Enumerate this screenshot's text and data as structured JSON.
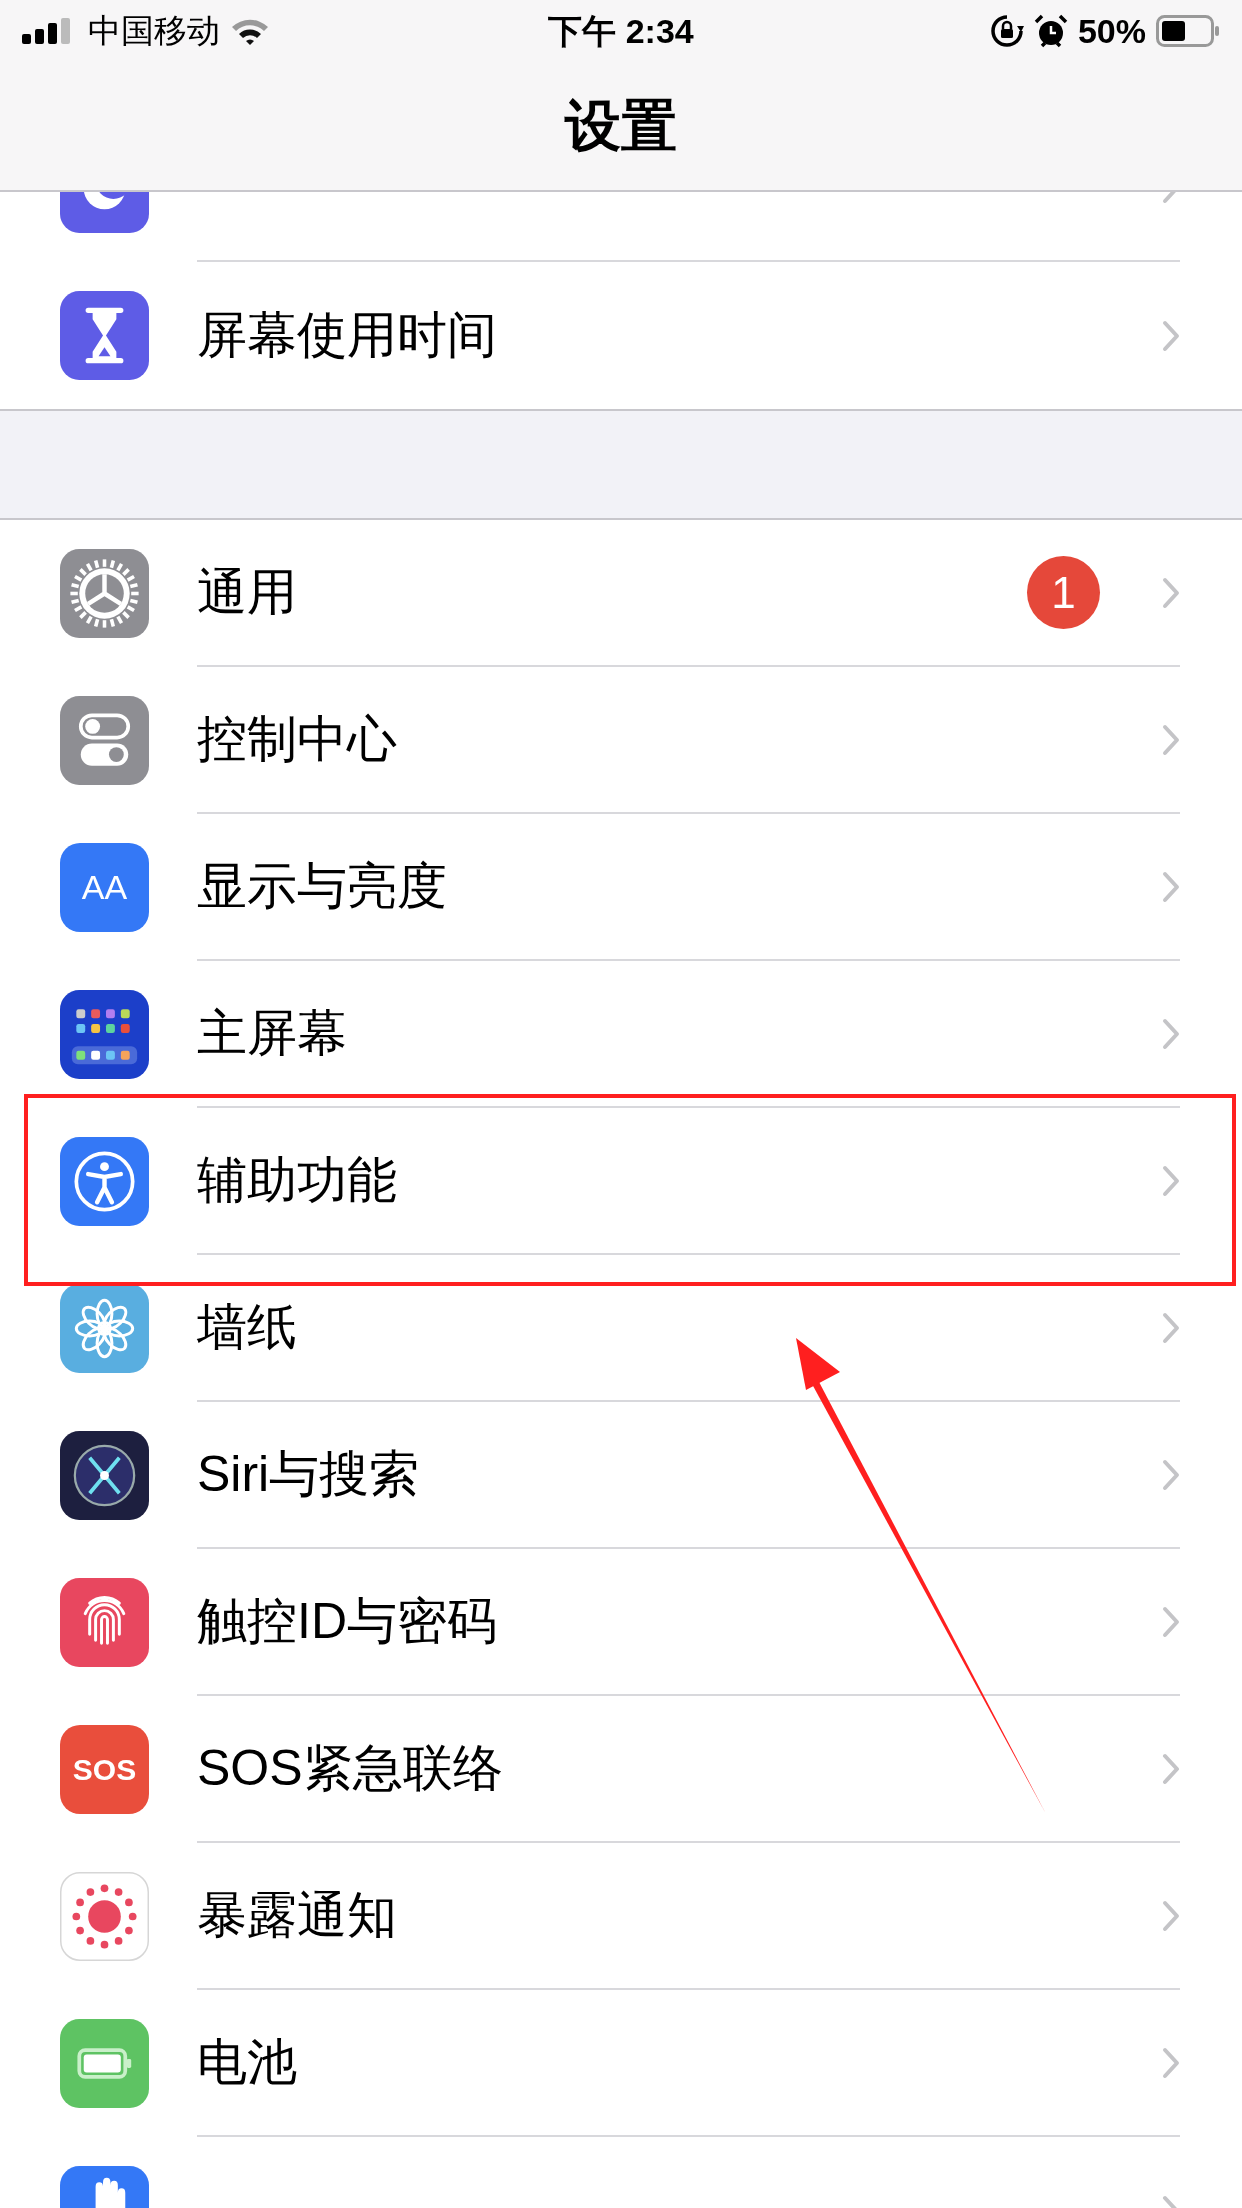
{
  "status_bar": {
    "carrier": "中国移动",
    "time": "下午 2:34",
    "battery": "50%"
  },
  "navigation": {
    "title": "设置"
  },
  "groups": [
    {
      "rows": [
        {
          "highlighted": false
        },
        {
          "label": "屏幕使用时间",
          "highlighted": false
        }
      ]
    },
    {
      "rows": [
        {
          "label": "通用",
          "badge": "1",
          "highlighted": false
        },
        {
          "label": "控制中心",
          "highlighted": false
        },
        {
          "label": "显示与亮度",
          "icon_label": "AA",
          "highlighted": false
        },
        {
          "label": "主屏幕",
          "highlighted": false
        },
        {
          "label": "辅助功能",
          "highlighted": true
        },
        {
          "label": "墙纸",
          "highlighted": false
        },
        {
          "label": "Siri与搜索",
          "highlighted": false
        },
        {
          "label": "触控ID与密码",
          "highlighted": false
        },
        {
          "label": "SOS紧急联络",
          "icon_label": "SOS",
          "highlighted": false
        },
        {
          "label": "暴露通知",
          "highlighted": false
        },
        {
          "label": "电池",
          "highlighted": false
        },
        {
          "highlighted": false
        }
      ]
    }
  ],
  "annotations": [
    {
      "kind": "arrow"
    }
  ]
}
